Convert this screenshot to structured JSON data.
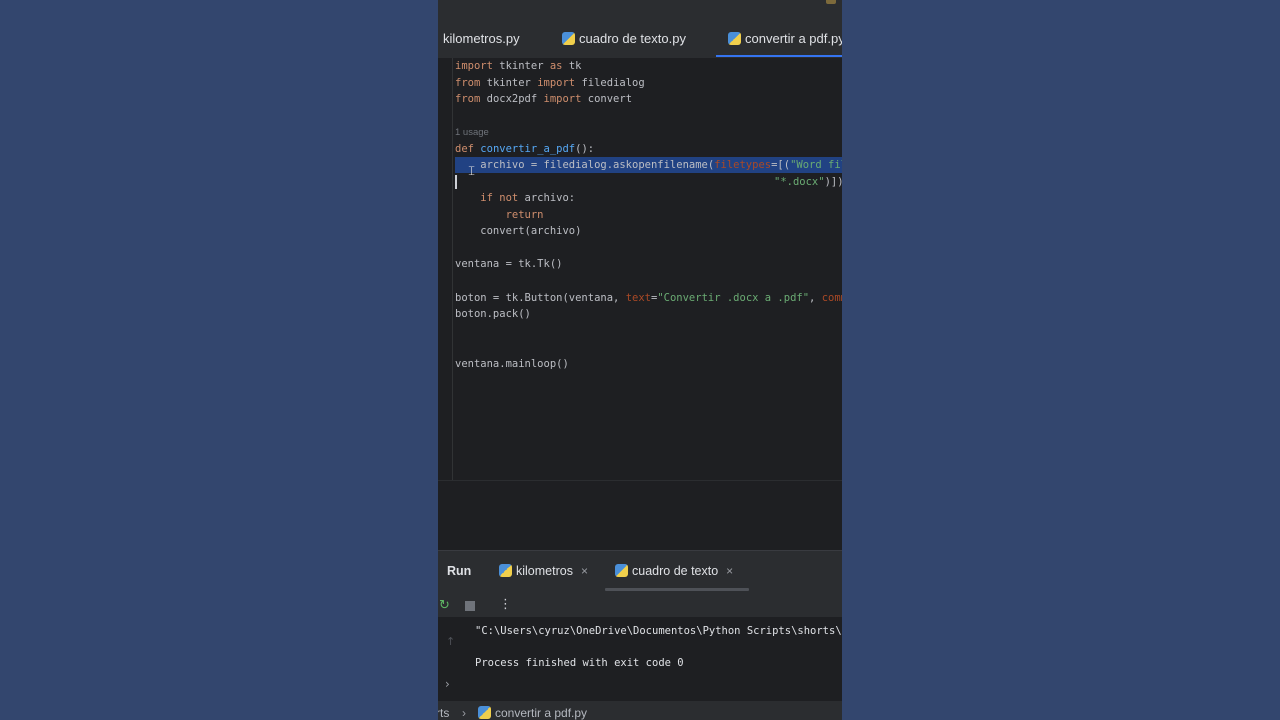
{
  "tabs": [
    {
      "label": "kilometros.py",
      "active": false
    },
    {
      "label": "cuadro de texto.py",
      "active": false
    },
    {
      "label": "convertir a pdf.py",
      "active": true
    }
  ],
  "editor": {
    "line1": {
      "k1": "import",
      "t1": " tkinter ",
      "k2": "as",
      "t2": " tk"
    },
    "line2": {
      "k1": "from",
      "t1": " tkinter ",
      "k2": "import",
      "t2": " filedialog"
    },
    "line3": {
      "k1": "from",
      "t1": " docx2pdf ",
      "k2": "import",
      "t2": " convert"
    },
    "usage_hint": "1 usage",
    "line5": {
      "k1": "def",
      "fn": "convertir_a_pdf",
      "t1": "():"
    },
    "line6": {
      "t1": "    archivo = filedialog.askopenfilename(",
      "p1": "filetypes",
      "t2": "=[(",
      "s1": "\"Word files\""
    },
    "line7": {
      "s1": "\"*.docx\"",
      "t1": ")])"
    },
    "line8": {
      "k1": "    if not",
      "t1": " archivo:"
    },
    "line9": {
      "k1": "        return"
    },
    "line10": {
      "t1": "    convert(archivo)"
    },
    "line11": {
      "t1": "ventana = tk.Tk()"
    },
    "line12": {
      "t1": "boton = tk.Button(ventana, ",
      "p1": "text",
      "t2": "=",
      "s1": "\"Convertir .docx a .pdf\"",
      "t3": ", ",
      "p2": "command"
    },
    "line13": {
      "t1": "boton.pack()"
    },
    "line14": {
      "t1": "ventana.mainloop()"
    }
  },
  "run": {
    "title": "Run",
    "tabs": [
      {
        "label": "kilometros"
      },
      {
        "label": "cuadro de texto"
      }
    ],
    "close_glyph": "×",
    "output": [
      "\"C:\\Users\\cyruz\\OneDrive\\Documentos\\Python Scripts\\shorts\\Scrip",
      "Process finished with exit code 0"
    ]
  },
  "status": {
    "crumb1": "rts",
    "crumb2": "convertir a pdf.py"
  },
  "colors": {
    "background": "#33466e",
    "ide": "#1e1f22",
    "accent": "#3574f0",
    "selection": "#214283"
  }
}
